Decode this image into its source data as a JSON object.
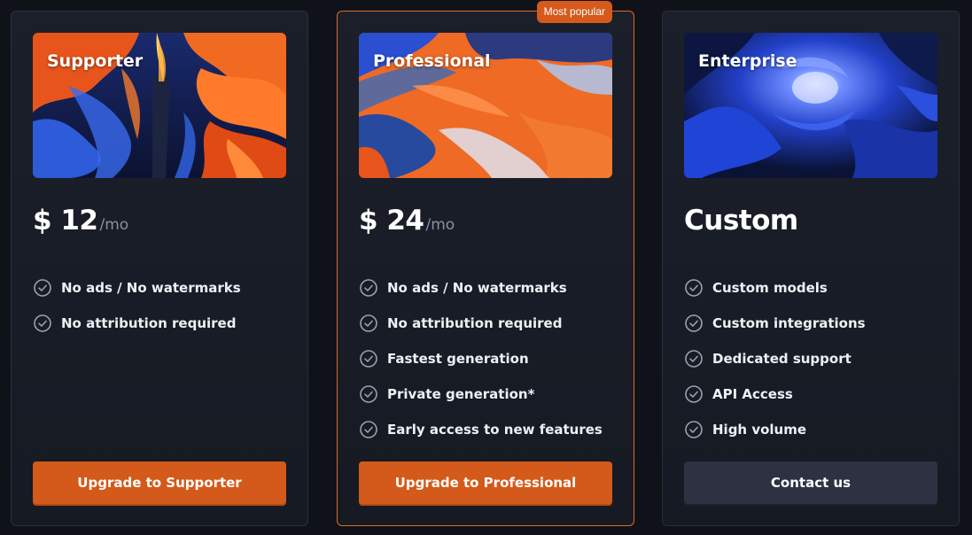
{
  "plans": [
    {
      "name": "Supporter",
      "price": "$ 12",
      "period": "/mo",
      "features": [
        "No ads / No watermarks",
        "No attribution required"
      ],
      "cta_label": "Upgrade to Supporter",
      "art_icon": "abstract-flame-artwork"
    },
    {
      "name": "Professional",
      "badge": "Most popular",
      "price": "$ 24",
      "period": "/mo",
      "features": [
        "No ads / No watermarks",
        "No attribution required",
        "Fastest generation",
        "Private generation*",
        "Early access to new features"
      ],
      "cta_label": "Upgrade to Professional",
      "art_icon": "abstract-wave-artwork"
    },
    {
      "name": "Enterprise",
      "price": "Custom",
      "period": "",
      "features": [
        "Custom models",
        "Custom integrations",
        "Dedicated support",
        "API Access",
        "High volume"
      ],
      "cta_label": "Contact us",
      "art_icon": "abstract-blue-swirl-artwork"
    }
  ],
  "colors": {
    "accent": "#d35a1a",
    "featured_border": "#e06a24",
    "card_bg": "#1b1f2a",
    "page_bg": "#0f1219",
    "muted_text": "#8b90a0",
    "check_icon": "#9aa0ad"
  }
}
